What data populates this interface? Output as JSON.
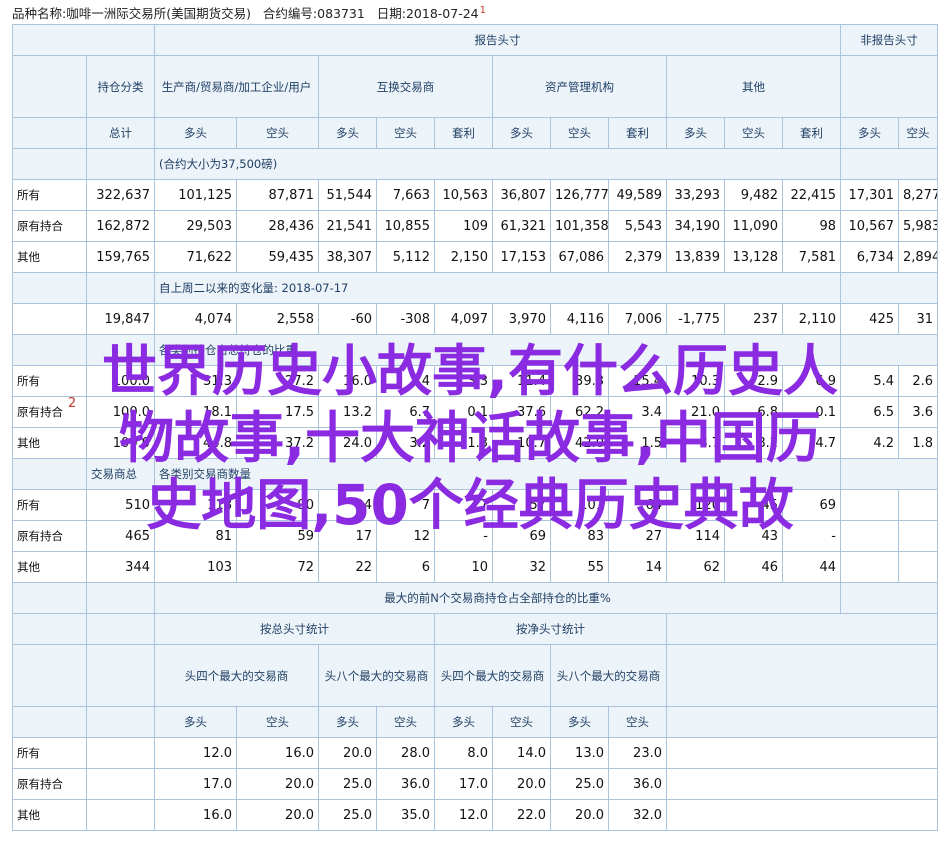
{
  "header": {
    "prefix": "品种名称:",
    "product": "咖啡一洲际交易所(美国期货交易)",
    "code_label": "合约编号:",
    "code": "083731",
    "date_label": "日期:",
    "date": "2018-07-24",
    "marker": "1"
  },
  "cols": {
    "report_group": "报告头寸",
    "non_report": "非报告头寸",
    "holding_cat": "持仓分类",
    "producer": "生产商/贸易商/加工企业/用户",
    "swap": "互换交易商",
    "managed": "资产管理机构",
    "other": "其他",
    "total": "总计",
    "long": "多头",
    "short": "空头",
    "spread": "套利"
  },
  "notes": {
    "unit": "(合约大小为37,500磅)",
    "change": "自上周二以来的变化量: 2018-07-17",
    "pct": "各类别持仓占总持仓的比重",
    "traders_a": "交易商总",
    "traders_b": "各类别交易商数量",
    "conc": "最大的前N个交易商持仓占全部持仓的比重%"
  },
  "rows": {
    "all": "所有",
    "old": "原有持合",
    "other": "其他"
  },
  "positions": [
    [
      "322,637",
      "101,125",
      "87,871",
      "51,544",
      "7,663",
      "10,563",
      "36,807",
      "126,777",
      "49,589",
      "33,293",
      "9,482",
      "22,415",
      "17,301",
      "8,277"
    ],
    [
      "162,872",
      "29,503",
      "28,436",
      "21,541",
      "10,855",
      "109",
      "61,321",
      "101,358",
      "5,543",
      "34,190",
      "11,090",
      "98",
      "10,567",
      "5,983"
    ],
    [
      "159,765",
      "71,622",
      "59,435",
      "38,307",
      "5,112",
      "2,150",
      "17,153",
      "67,086",
      "2,379",
      "13,839",
      "13,128",
      "7,581",
      "6,734",
      "2,894"
    ]
  ],
  "changes": [
    "19,847",
    "4,074",
    "2,558",
    "-60",
    "-308",
    "4,097",
    "3,970",
    "4,116",
    "7,006",
    "-1,775",
    "237",
    "2,110",
    "425",
    "31"
  ],
  "percents": [
    [
      "100.0",
      "31.3",
      "27.2",
      "16.0",
      "2.4",
      "3.3",
      "11.4",
      "39.3",
      "15.4",
      "10.3",
      "2.9",
      "6.9",
      "5.4",
      "2.6"
    ],
    [
      "100.0",
      "18.1",
      "17.5",
      "13.2",
      "6.7",
      "0.1",
      "37.6",
      "62.2",
      "3.4",
      "21.0",
      "6.8",
      "0.1",
      "6.5",
      "3.6"
    ],
    [
      "100.0",
      "44.8",
      "37.2",
      "24.0",
      "3.2",
      "1.3",
      "10.7",
      "42.0",
      "1.5",
      "8.7",
      "8.2",
      "4.7",
      "4.2",
      "1.8"
    ]
  ],
  "traders": [
    [
      "510",
      "118",
      "90",
      "24",
      "7",
      "17",
      "57",
      "101",
      "64",
      "120",
      "45",
      "69",
      "",
      ""
    ],
    [
      "465",
      "81",
      "59",
      "17",
      "12",
      "-",
      "69",
      "83",
      "27",
      "114",
      "43",
      "-",
      "",
      ""
    ],
    [
      "344",
      "103",
      "72",
      "22",
      "6",
      "10",
      "32",
      "55",
      "14",
      "62",
      "46",
      "44",
      "",
      ""
    ]
  ],
  "conc_headers": {
    "gross": "按总头寸统计",
    "net": "按净头寸统计",
    "top4": "头四个最大的交易商",
    "top8": "头八个最大的交易商"
  },
  "concentration": [
    [
      "12.0",
      "16.0",
      "20.0",
      "28.0",
      "8.0",
      "14.0",
      "13.0",
      "23.0"
    ],
    [
      "17.0",
      "20.0",
      "25.0",
      "36.0",
      "17.0",
      "20.0",
      "25.0",
      "36.0"
    ],
    [
      "16.0",
      "20.0",
      "25.0",
      "35.0",
      "12.0",
      "22.0",
      "20.0",
      "32.0"
    ]
  ],
  "overlay": {
    "line1": "世界历史小故事,有什么历史人",
    "line2": "物故事,十大神话故事,中国历",
    "line3": "史地图,50个经典历史典故",
    "mark2": "2"
  }
}
